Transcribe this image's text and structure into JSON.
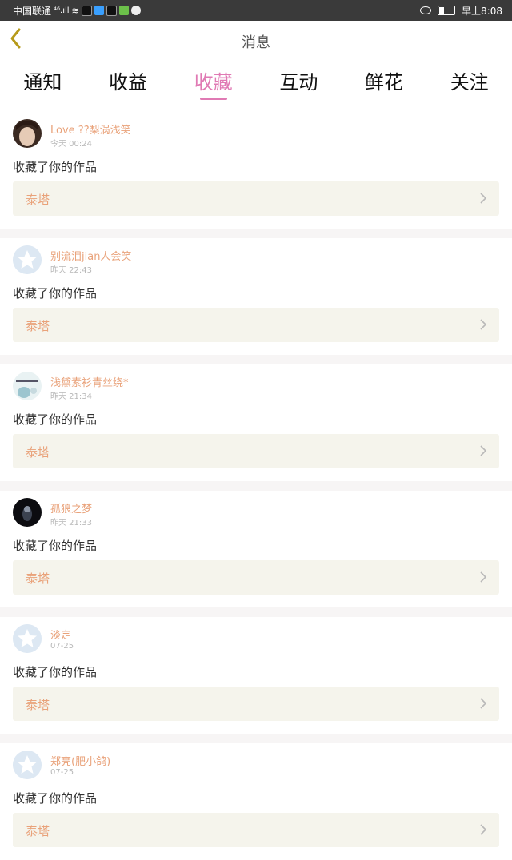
{
  "status_bar": {
    "carrier": "中国联通",
    "network": "⁴⁶.ıll",
    "time": "早上8:08"
  },
  "header": {
    "title": "消息"
  },
  "tabs": [
    {
      "label": "通知",
      "active": false
    },
    {
      "label": "收益",
      "active": false
    },
    {
      "label": "收藏",
      "active": true
    },
    {
      "label": "互动",
      "active": false
    },
    {
      "label": "鲜花",
      "active": false
    },
    {
      "label": "关注",
      "active": false
    }
  ],
  "accent_color": "#e07ab4",
  "name_color": "#e9a27a",
  "notifications": [
    {
      "username": "Love ??梨涡浅笑",
      "time": "今天 00:24",
      "action": "收藏了你的作品",
      "work": "泰塔",
      "avatar": "photo-girl"
    },
    {
      "username": "别流泪jian人会笑",
      "time": "昨天 22:43",
      "action": "收藏了你的作品",
      "work": "泰塔",
      "avatar": "default"
    },
    {
      "username": "浅黛素衫青丝绕*",
      "time": "昨天 21:34",
      "action": "收藏了你的作品",
      "work": "泰塔",
      "avatar": "photo-art"
    },
    {
      "username": "孤狼之梦",
      "time": "昨天 21:33",
      "action": "收藏了你的作品",
      "work": "泰塔",
      "avatar": "photo-dark"
    },
    {
      "username": "淡定",
      "time": "07-25",
      "action": "收藏了你的作品",
      "work": "泰塔",
      "avatar": "default"
    },
    {
      "username": "郑亮(肥小鸽)",
      "time": "07-25",
      "action": "收藏了你的作品",
      "work": "泰塔",
      "avatar": "default"
    }
  ]
}
